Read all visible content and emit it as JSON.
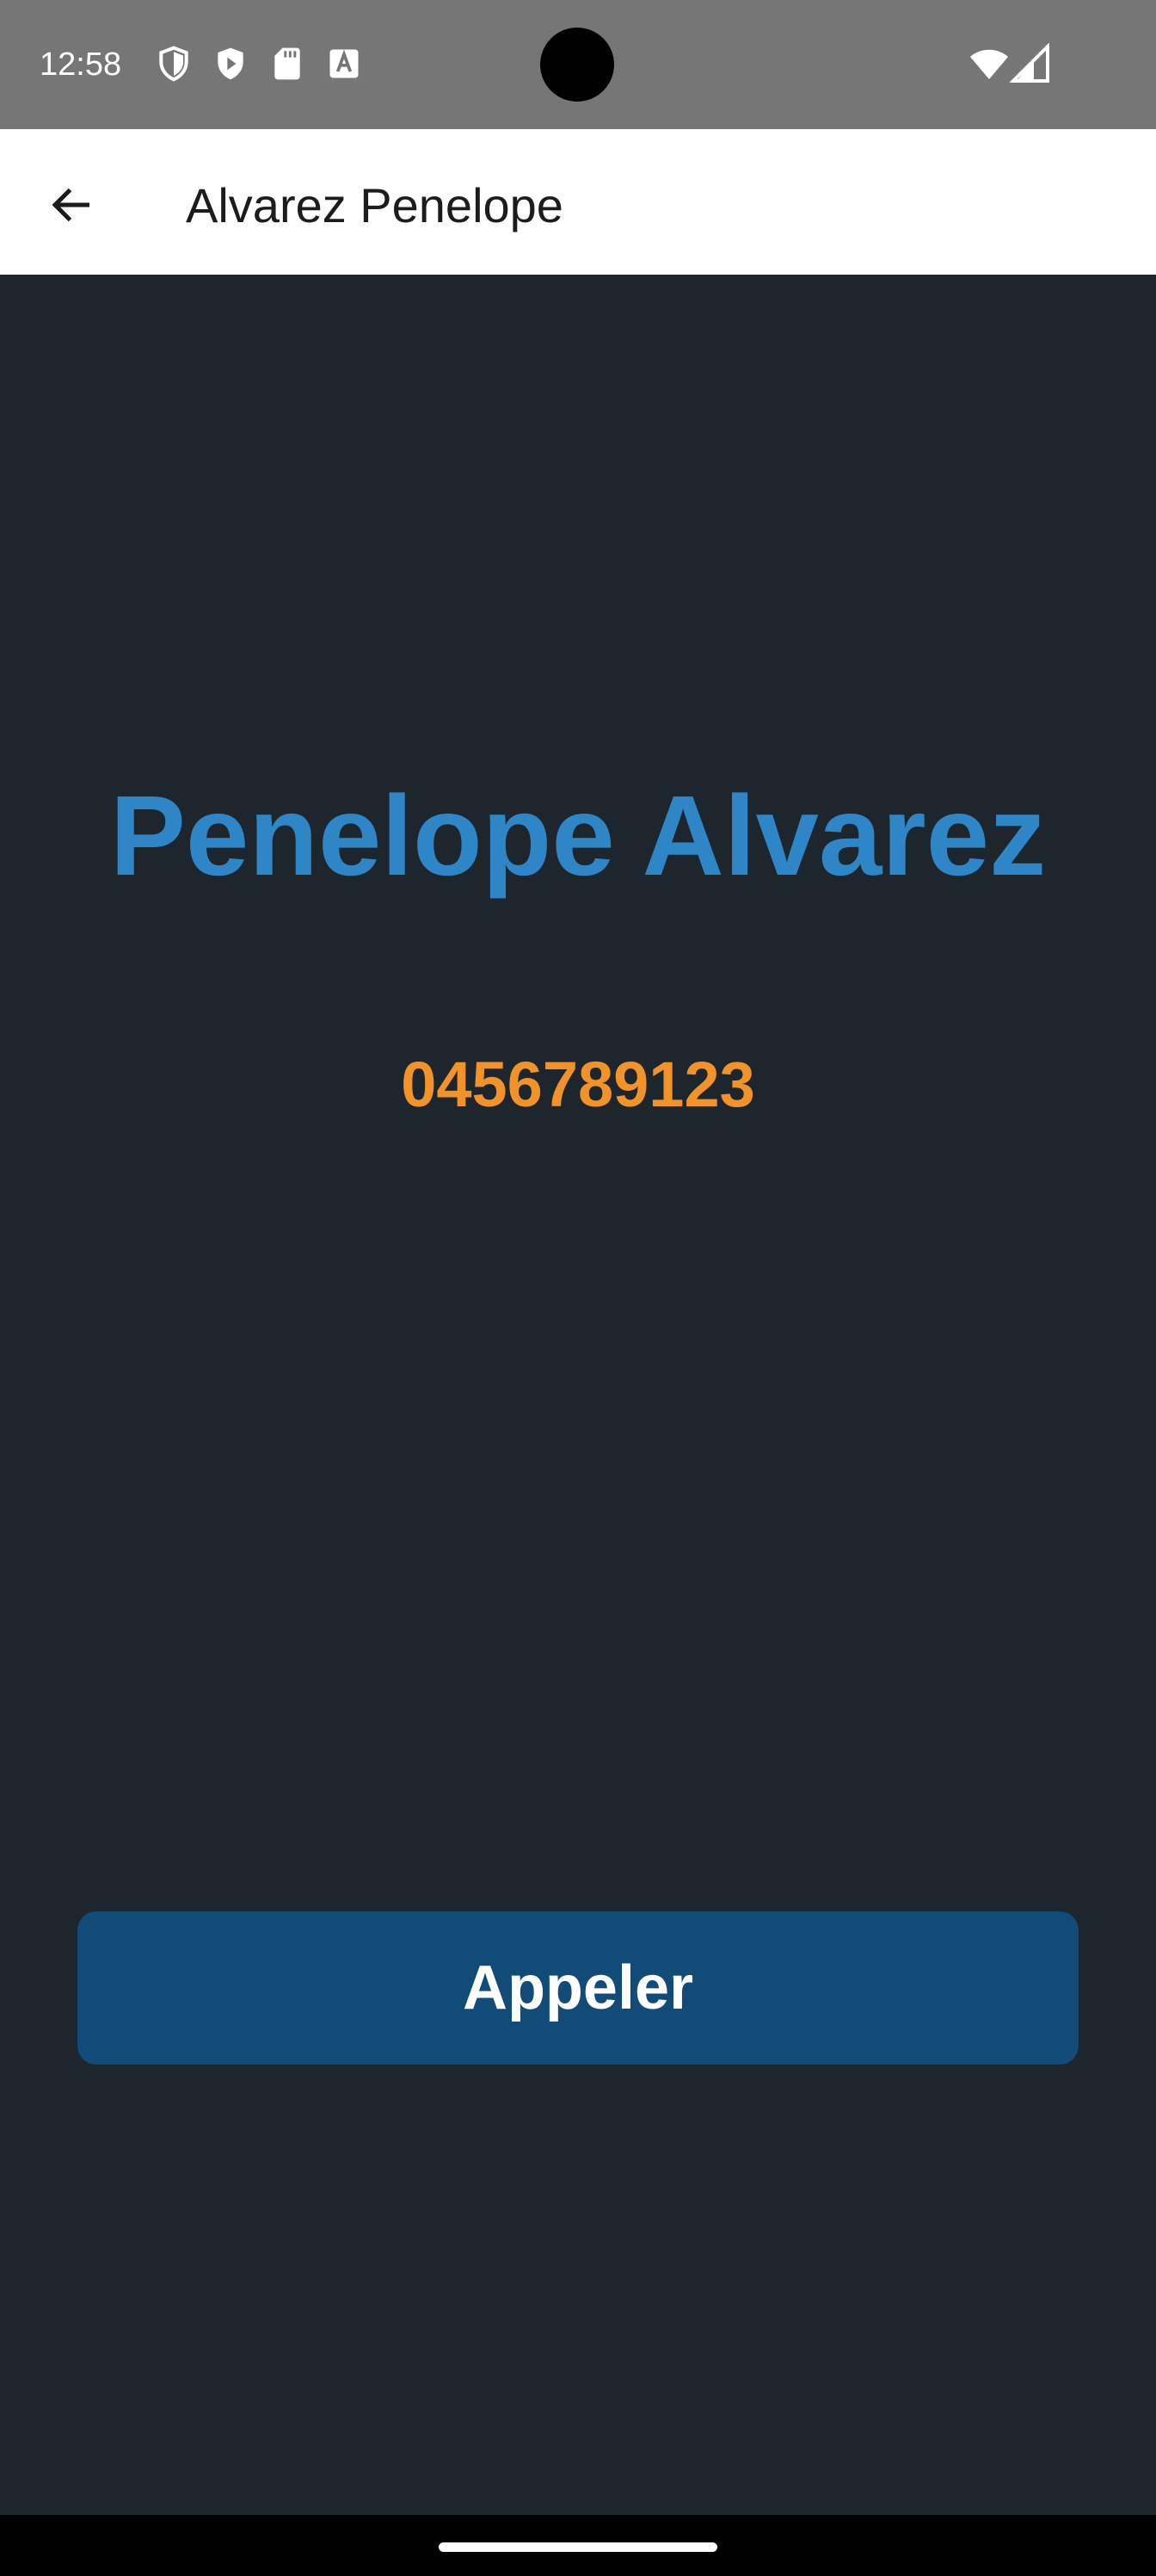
{
  "status_bar": {
    "time": "12:58",
    "icons": [
      "shield-icon",
      "play-store-icon",
      "sd-card-icon",
      "text-a-icon",
      "wifi-icon",
      "cell-signal-icon"
    ]
  },
  "app_bar": {
    "back_icon": "arrow-back-icon",
    "title": "Alvarez Penelope"
  },
  "contact": {
    "full_name": "Penelope Alvarez",
    "phone": "0456789123"
  },
  "actions": {
    "call_label": "Appeler"
  },
  "colors": {
    "status_bar_bg": "#767676",
    "app_bar_bg": "#ffffff",
    "content_bg": "#1e262d",
    "name_color": "#2e86c6",
    "phone_color": "#f2932a",
    "button_bg": "#114c79",
    "button_text": "#ffffff"
  }
}
